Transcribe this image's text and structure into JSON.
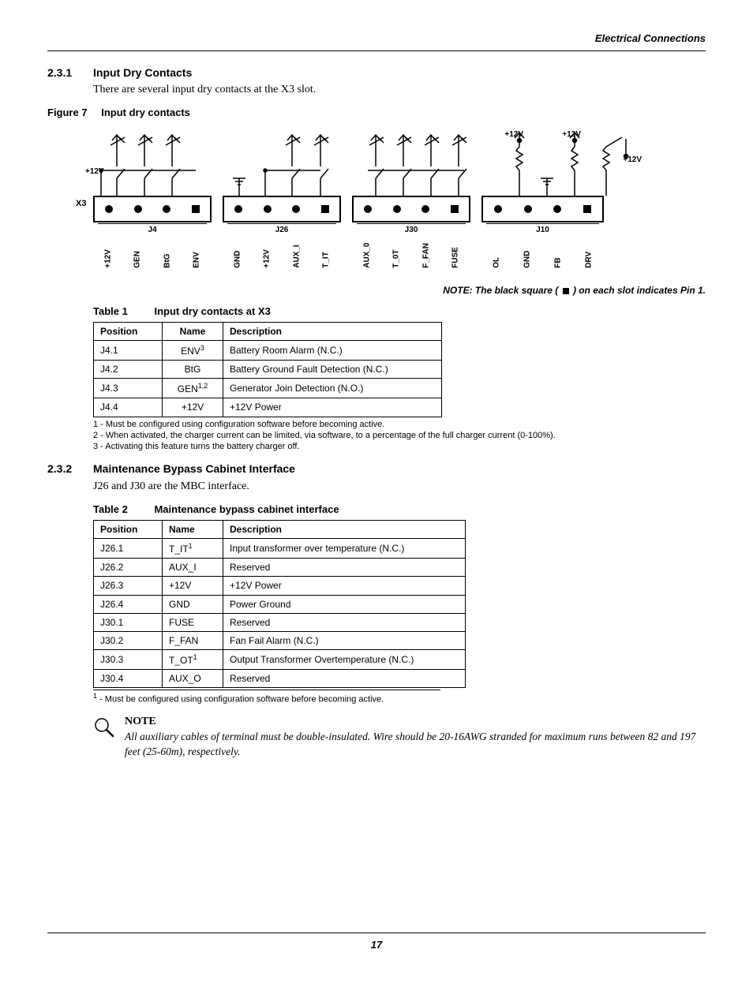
{
  "header": {
    "section": "Electrical Connections"
  },
  "sec231": {
    "num": "2.3.1",
    "title": "Input Dry Contacts",
    "body": "There are several input dry contacts at the X3 slot."
  },
  "fig7": {
    "label": "Figure 7",
    "title": "Input dry contacts",
    "x3": "X3",
    "v12_left": "+12V",
    "top_v12_a": "+12V",
    "top_v12_b": "+12V",
    "top_v12_c": "+12V",
    "groups": [
      {
        "j": "J4",
        "pins": [
          "+12V",
          "GEN",
          "BtG",
          "ENV"
        ]
      },
      {
        "j": "J26",
        "pins": [
          "GND",
          "+12V",
          "AUX_I",
          "T_IT"
        ]
      },
      {
        "j": "J30",
        "pins": [
          "AUX_0",
          "T_0T",
          "F_FAN",
          "FUSE"
        ]
      },
      {
        "j": "J10",
        "pins": [
          "OL",
          "GND",
          "FB",
          "DRV"
        ]
      }
    ],
    "note_pre": "NOTE: The black square ( ",
    "note_post": " ) on each slot indicates Pin 1."
  },
  "table1": {
    "label": "Table 1",
    "title": "Input dry contacts at X3",
    "headers": [
      "Position",
      "Name",
      "Description"
    ],
    "rows": [
      {
        "pos": "J4.1",
        "name": "ENV",
        "sup": "3",
        "desc": "Battery Room Alarm (N.C.)"
      },
      {
        "pos": "J4.2",
        "name": "BtG",
        "sup": "",
        "desc": "Battery Ground Fault Detection (N.C.)"
      },
      {
        "pos": "J4.3",
        "name": "GEN",
        "sup": "1,2",
        "desc": "Generator Join Detection (N.O.)"
      },
      {
        "pos": "J4.4",
        "name": "+12V",
        "sup": "",
        "desc": "+12V Power"
      }
    ],
    "foot1": "1 - Must be configured using configuration software before becoming active.",
    "foot2": "2 - When activated, the charger current can be limited, via software, to a percentage of the full charger current (0-100%).",
    "foot3": "3 - Activating this feature turns the battery charger off."
  },
  "sec232": {
    "num": "2.3.2",
    "title": "Maintenance Bypass Cabinet Interface",
    "body": "J26 and J30 are the MBC interface."
  },
  "table2": {
    "label": "Table 2",
    "title": "Maintenance bypass cabinet interface",
    "headers": [
      "Position",
      "Name",
      "Description"
    ],
    "rows": [
      {
        "pos": "J26.1",
        "name": "T_IT",
        "sup": "1",
        "desc": "Input transformer over temperature (N.C.)"
      },
      {
        "pos": "J26.2",
        "name": "AUX_I",
        "sup": "",
        "desc": "Reserved"
      },
      {
        "pos": "J26.3",
        "name": "+12V",
        "sup": "",
        "desc": "+12V Power"
      },
      {
        "pos": "J26.4",
        "name": "GND",
        "sup": "",
        "desc": "Power Ground"
      },
      {
        "pos": "J30.1",
        "name": "FUSE",
        "sup": "",
        "desc": "Reserved"
      },
      {
        "pos": "J30.2",
        "name": "F_FAN",
        "sup": "",
        "desc": "Fan Fail Alarm (N.C.)"
      },
      {
        "pos": "J30.3",
        "name": "T_OT",
        "sup": "1",
        "desc": "Output Transformer Overtemperature (N.C.)"
      },
      {
        "pos": "J30.4",
        "name": "AUX_O",
        "sup": "",
        "desc": "Reserved"
      }
    ],
    "foot1_sup": "1",
    "foot1": " - Must be configured using configuration software before becoming active."
  },
  "note": {
    "title": "NOTE",
    "body": "All auxiliary cables of terminal must be double-insulated. Wire should be 20-16AWG stranded for maximum runs between 82 and 197 feet (25-60m), respectively."
  },
  "page": "17"
}
